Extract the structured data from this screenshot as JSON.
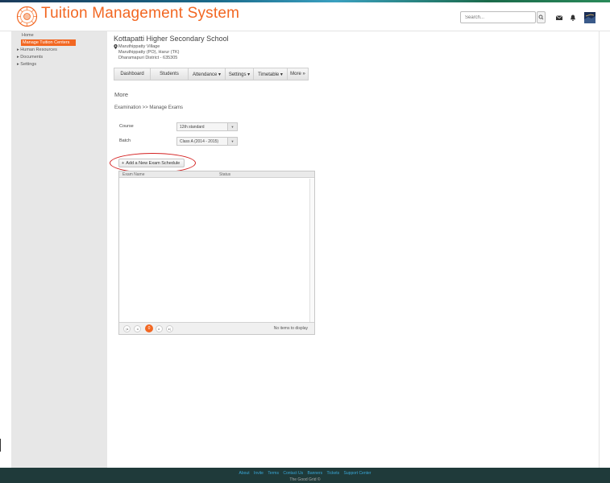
{
  "header": {
    "title": "Tuition Management System",
    "search_placeholder": "Search...",
    "icons": [
      "logo-emblem-icon",
      "search-icon",
      "mail-icon",
      "bell-icon",
      "avatar"
    ]
  },
  "sidebar": {
    "items": [
      {
        "label": "Home"
      },
      {
        "label": "Manage Tuition  Centers",
        "active": true
      },
      {
        "label": "Human Resources"
      },
      {
        "label": "Documents"
      },
      {
        "label": "Settings"
      }
    ]
  },
  "school": {
    "name": "Kottapatti Higher Secondary School",
    "address_lines": [
      "Maruthippatty Village",
      "Maruthippatty (PO), Harur (TK)",
      "Dharamapuri District - 635305"
    ]
  },
  "nav": {
    "items": [
      "Dashboard",
      "Students",
      "Attendance ▾",
      "Settings ▾",
      "Timetable ▾",
      "More »"
    ]
  },
  "main": {
    "section_title": "More",
    "breadcrumb": "Examination >> Manage Exams",
    "course_label": "Course",
    "course_value": "12th standard",
    "batch_label": "Batch",
    "batch_value": "Class A (2014 - 2015)",
    "add_button": "Add a New Exam Schedule",
    "add_button_icon": "+"
  },
  "grid": {
    "columns": [
      "Exam Name",
      "Status"
    ],
    "current_page": "0",
    "empty_text": "No items to display",
    "pager_icons": [
      "|◂",
      "◂",
      "▸",
      "▸|"
    ]
  },
  "colors": {
    "accent": "#f26722",
    "highlight": "#d42020",
    "footer": "#1f3a3a"
  },
  "footer": {
    "links": [
      "About",
      "Invite",
      "Terms",
      "Contact Us",
      "Banners",
      "Tickets",
      "Support Center"
    ],
    "copyright": "The Good Grid ©"
  }
}
